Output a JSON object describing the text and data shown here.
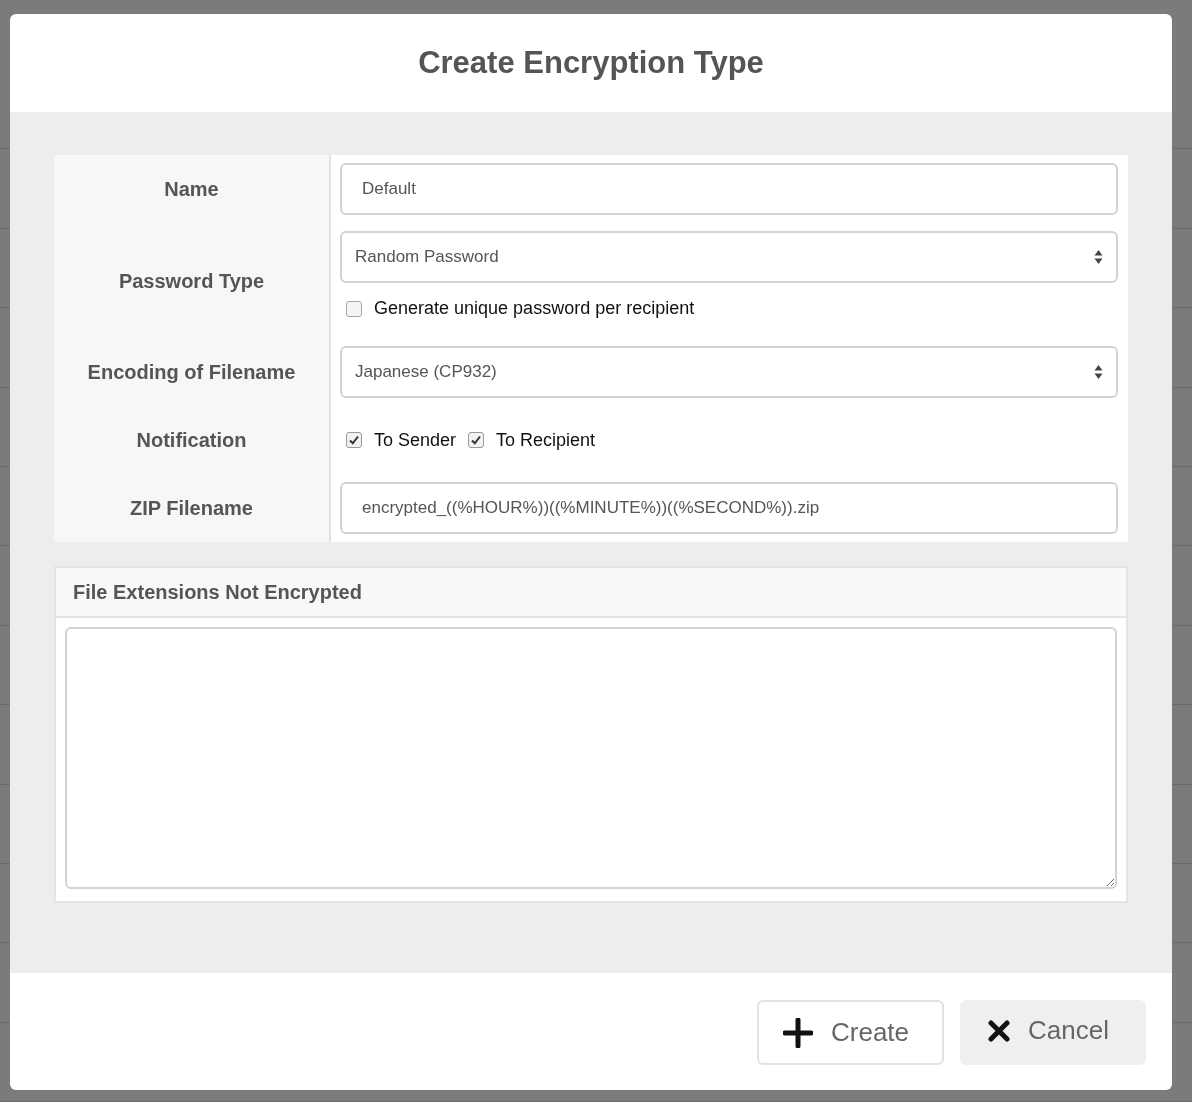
{
  "dialog": {
    "title": "Create Encryption Type"
  },
  "form": {
    "fields": [
      {
        "kind": "text",
        "label": "Name",
        "value": "Default"
      },
      {
        "kind": "select",
        "label": "Password Type",
        "value": "Random Password",
        "options": [
          {
            "label": "Generate unique password per recipient",
            "checked": false
          }
        ]
      },
      {
        "kind": "select",
        "label": "Encoding of Filename",
        "value": "Japanese (CP932)"
      },
      {
        "kind": "checks",
        "label": "Notification",
        "options": [
          {
            "label": "To Sender",
            "checked": true
          },
          {
            "label": "To Recipient",
            "checked": true
          }
        ]
      },
      {
        "kind": "text",
        "label": "ZIP Filename",
        "value": "encrypted_((%HOUR%))((%MINUTE%))((%SECOND%)).zip"
      }
    ]
  },
  "extensions_panel": {
    "title": "File Extensions Not Encrypted"
  },
  "buttons": [
    {
      "kind": "create",
      "label": "Create"
    },
    {
      "kind": "cancel",
      "label": "Cancel"
    }
  ]
}
